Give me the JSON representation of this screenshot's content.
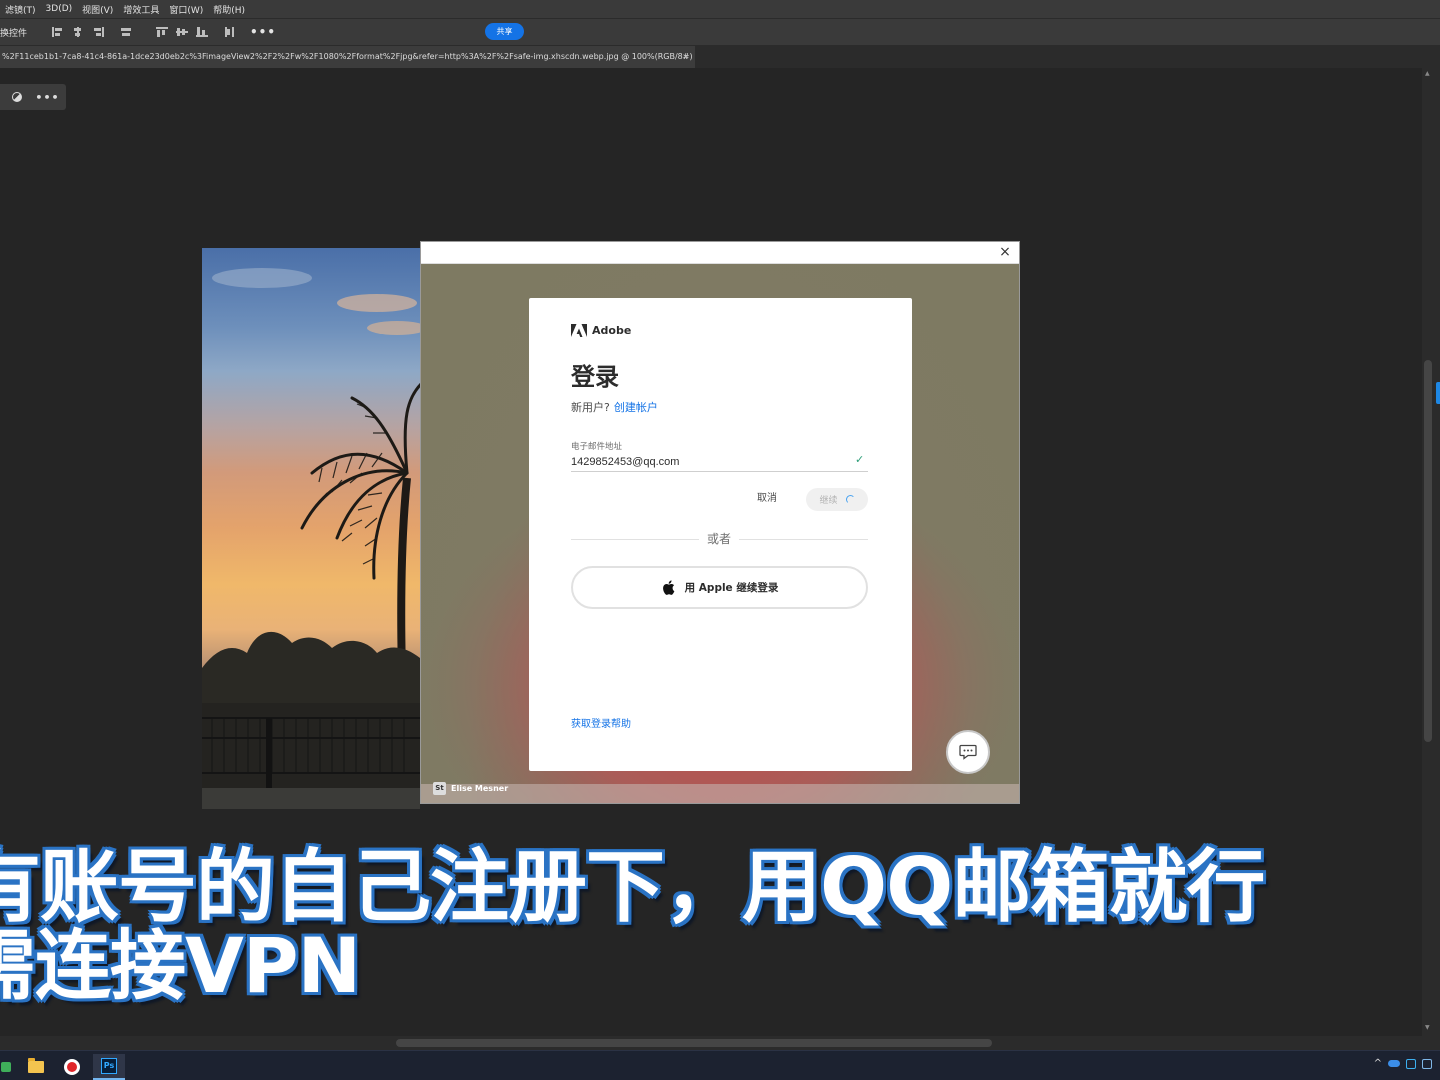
{
  "menu": {
    "items": [
      "滤镜(T)",
      "3D(D)",
      "视图(V)",
      "增效工具",
      "窗口(W)",
      "帮助(H)"
    ]
  },
  "options_bar": {
    "label": "换控件",
    "more": "•••",
    "share": "共享"
  },
  "document_tab": {
    "title": "%2F11ceb1b1-7ca8-41c4-861a-1dce23d0eb2c%3FimageView2%2F2%2Fw%2F1080%2Fformat%2Fjpg&refer=http%3A%2F%2Fsafe-img.xhscdn.webp.jpg @ 100%(RGB/8#)",
    "close": "×"
  },
  "context_toolbar": {
    "more": "•••"
  },
  "login": {
    "close": "×",
    "brand": "Adobe",
    "title": "登录",
    "new_user_prompt": "新用户?",
    "create_account": "创建帐户",
    "email_label": "电子邮件地址",
    "email_value": "1429852453@qq.com",
    "check": "✓",
    "cancel": "取消",
    "continue": "继续",
    "or": "或者",
    "apple_signin": "用 Apple 继续登录",
    "help": "获取登录帮助",
    "photo_credit": "Elise Mesner",
    "credit_badge": "St"
  },
  "subtitles": {
    "line1": "有账号的自己注册下，用QQ邮箱就行",
    "line2": "需连接VPN"
  },
  "taskbar": {
    "ps_label": "Ps",
    "tray_chevron": "^"
  },
  "colors": {
    "accent_blue": "#1473e6",
    "ps_dark": "#252525",
    "subtitle_outline": "#2a73c4",
    "valid_green": "#2d9d78"
  }
}
